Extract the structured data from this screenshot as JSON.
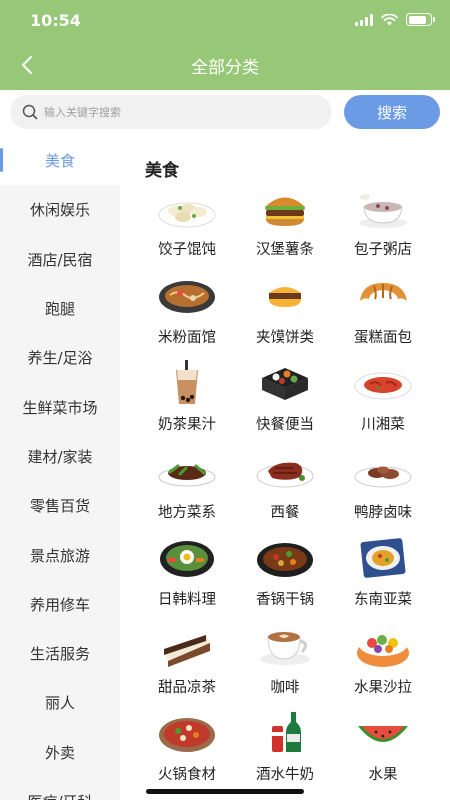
{
  "status": {
    "time": "10:54",
    "battery_level": 0.85
  },
  "nav": {
    "title": "全部分类",
    "back_icon": "chevron-left-icon"
  },
  "search": {
    "placeholder": "输入关键字搜索",
    "value": "",
    "button_label": "搜索",
    "icon": "search-icon"
  },
  "colors": {
    "header_bg": "#96c878",
    "accent": "#6b9be4",
    "sidebar_bg": "#f5f5f5"
  },
  "sidebar": {
    "selected_index": 0,
    "items": [
      {
        "label": "美食"
      },
      {
        "label": "休闲娱乐"
      },
      {
        "label": "酒店/民宿"
      },
      {
        "label": "跑腿"
      },
      {
        "label": "养生/足浴"
      },
      {
        "label": "生鲜菜市场"
      },
      {
        "label": "建材/家装"
      },
      {
        "label": "零售百货"
      },
      {
        "label": "景点旅游"
      },
      {
        "label": "养用修车"
      },
      {
        "label": "生活服务"
      },
      {
        "label": "丽人"
      },
      {
        "label": "外卖"
      },
      {
        "label": "医疗/牙科"
      }
    ]
  },
  "main": {
    "section_title": "美食",
    "categories": [
      {
        "label": "饺子馄饨",
        "icon": "dumplings-icon"
      },
      {
        "label": "汉堡薯条",
        "icon": "burger-icon"
      },
      {
        "label": "包子粥店",
        "icon": "congee-icon"
      },
      {
        "label": "米粉面馆",
        "icon": "noodle-bowl-icon"
      },
      {
        "label": "夹馍饼类",
        "icon": "sandwich-icon"
      },
      {
        "label": "蛋糕面包",
        "icon": "croissant-icon"
      },
      {
        "label": "奶茶果汁",
        "icon": "bubble-tea-icon"
      },
      {
        "label": "快餐便当",
        "icon": "bento-icon"
      },
      {
        "label": "川湘菜",
        "icon": "spicy-dish-icon"
      },
      {
        "label": "地方菜系",
        "icon": "stir-fry-plate-icon"
      },
      {
        "label": "西餐",
        "icon": "steak-icon"
      },
      {
        "label": "鸭脖卤味",
        "icon": "braised-meat-icon"
      },
      {
        "label": "日韩料理",
        "icon": "bibimbap-icon"
      },
      {
        "label": "香锅干锅",
        "icon": "dry-pot-icon"
      },
      {
        "label": "东南亚菜",
        "icon": "curry-plate-icon"
      },
      {
        "label": "甜品凉茶",
        "icon": "cake-slice-icon"
      },
      {
        "label": "咖啡",
        "icon": "coffee-cup-icon"
      },
      {
        "label": "水果沙拉",
        "icon": "fruit-salad-icon"
      },
      {
        "label": "火锅食材",
        "icon": "hotpot-icon"
      },
      {
        "label": "酒水牛奶",
        "icon": "drinks-icon"
      },
      {
        "label": "水果",
        "icon": "watermelon-icon"
      }
    ]
  }
}
